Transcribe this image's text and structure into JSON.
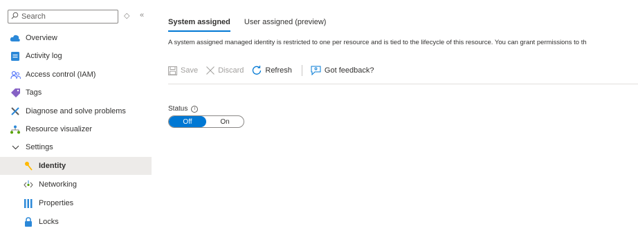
{
  "search": {
    "placeholder": "Search"
  },
  "sidebar": {
    "items": [
      {
        "label": "Overview",
        "icon": "cloud-icon"
      },
      {
        "label": "Activity log",
        "icon": "activity-log-icon"
      },
      {
        "label": "Access control (IAM)",
        "icon": "people-icon"
      },
      {
        "label": "Tags",
        "icon": "tag-icon"
      },
      {
        "label": "Diagnose and solve problems",
        "icon": "wrench-icon"
      },
      {
        "label": "Resource visualizer",
        "icon": "hierarchy-icon"
      },
      {
        "label": "Settings",
        "icon": "chevron-down-icon"
      },
      {
        "label": "Identity",
        "icon": "key-icon"
      },
      {
        "label": "Networking",
        "icon": "network-icon"
      },
      {
        "label": "Properties",
        "icon": "properties-icon"
      },
      {
        "label": "Locks",
        "icon": "lock-icon"
      }
    ]
  },
  "tabs": [
    {
      "label": "System assigned"
    },
    {
      "label": "User assigned (preview)"
    }
  ],
  "description": "A system assigned managed identity is restricted to one per resource and is tied to the lifecycle of this resource. You can grant permissions to th",
  "toolbar": {
    "save": "Save",
    "discard": "Discard",
    "refresh": "Refresh",
    "feedback": "Got feedback?"
  },
  "status": {
    "label": "Status",
    "off": "Off",
    "on": "On",
    "selected": "Off"
  },
  "colors": {
    "accent": "#0078d4",
    "active_bg": "#edebe9"
  }
}
